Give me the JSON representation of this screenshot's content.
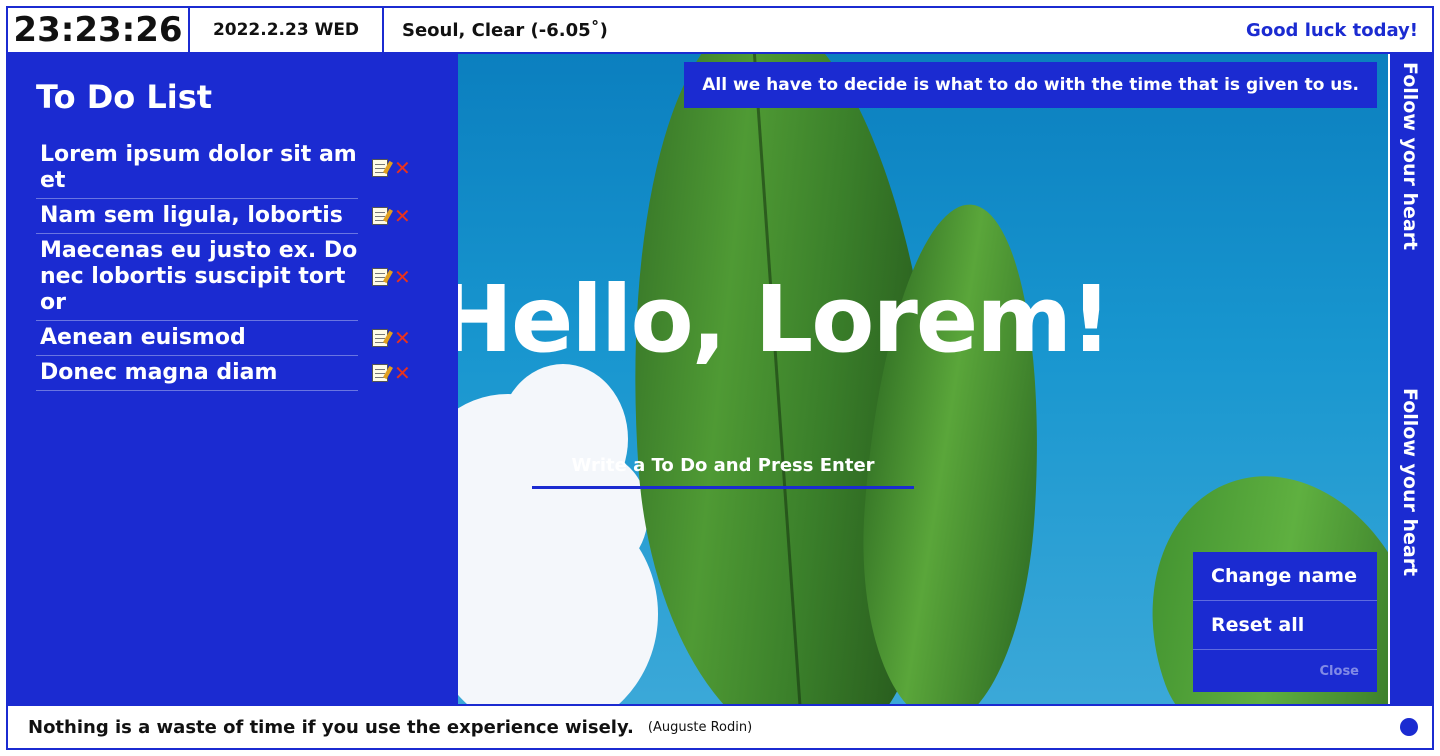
{
  "header": {
    "clock": "23:23:26",
    "date": "2022.2.23 WED",
    "weather": "Seoul, Clear (-6.05˚)",
    "message": "Good luck today!"
  },
  "todo": {
    "title": "To Do List",
    "items": [
      {
        "text": "Lorem ipsum dolor sit amet"
      },
      {
        "text": "Nam sem ligula, lobortis"
      },
      {
        "text": "Maecenas eu justo ex. Donec lobortis suscipit tortor"
      },
      {
        "text": "Aenean euismod"
      },
      {
        "text": "Donec magna diam"
      }
    ],
    "edit_icon": "edit-note-icon",
    "delete_icon": "delete-x-icon",
    "colors": {
      "panel": "#1b2bd1",
      "delete": "#e8321e"
    }
  },
  "main": {
    "quote": "All we have to decide is what to do with the time that is given to us.",
    "greeting": "Hello, Lorem!",
    "input_placeholder": "Write a To Do and Press Enter"
  },
  "menu": {
    "items": [
      {
        "label": "Change name"
      },
      {
        "label": "Reset all"
      }
    ],
    "close_label": "Close"
  },
  "side": {
    "text_top": "Follow your heart",
    "text_bottom": "Follow your heart"
  },
  "footer": {
    "quote": "Nothing is a waste of time if you use the experience wisely.",
    "author": "(Auguste Rodin)"
  },
  "theme": {
    "accent": "#1b2bd1",
    "background": "#ffffff"
  }
}
